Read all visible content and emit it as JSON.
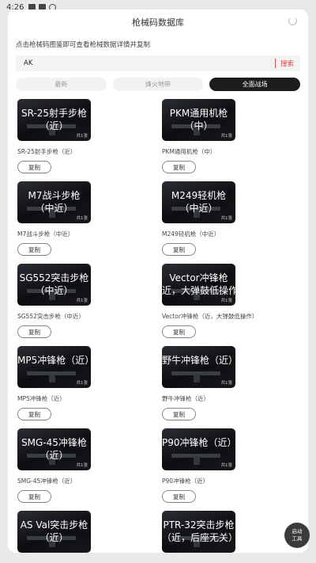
{
  "status_bar": {
    "time": "4:26"
  },
  "header": {
    "title": "枪械码数据库",
    "refresh_icon": "refresh-icon"
  },
  "hint": "点击枪械码图鉴即可查看枪械数据详情并复制",
  "search": {
    "value": "AK",
    "button": "搜索"
  },
  "tabs": [
    {
      "label": "最新",
      "active": false
    },
    {
      "label": "烽火地带",
      "active": false
    },
    {
      "label": "全面战场",
      "active": true
    }
  ],
  "items": [
    {
      "line1": "SR-25射手步枪",
      "line2": "（近）",
      "count": "共1张",
      "caption": "SR-25射手步枪（近）",
      "copy": "复制"
    },
    {
      "line1": "PKM通用机枪",
      "line2": "（中）",
      "count": "共1张",
      "caption": "PKM通用机枪（中）",
      "copy": "复制"
    },
    {
      "line1": "M7战斗步枪",
      "line2": "（中近）",
      "count": "共1张",
      "caption": "M7战斗步枪（中近）",
      "copy": "复制"
    },
    {
      "line1": "M249轻机枪",
      "line2": "（中近）",
      "count": "共1张",
      "caption": "M249轻机枪（中近）",
      "copy": "复制"
    },
    {
      "line1": "SG552突击步枪",
      "line2": "（中近）",
      "count": "共1张",
      "caption": "SG552突击步枪（中近）",
      "copy": "复制"
    },
    {
      "line1": "Vector冲锋枪",
      "line2": "近，大弹鼓低操作",
      "count": "共1张",
      "caption": "Vector冲锋枪（近，大弹鼓低操作）",
      "copy": "复制"
    },
    {
      "line1": "MP5冲锋枪（近）",
      "line2": "",
      "count": "共1张",
      "caption": "MP5冲锋枪（近）",
      "copy": "复制"
    },
    {
      "line1": "野牛冲锋枪（近）",
      "line2": "",
      "count": "共1张",
      "caption": "野牛冲锋枪（近）",
      "copy": "复制"
    },
    {
      "line1": "SMG-45冲锋枪",
      "line2": "（近）",
      "count": "共1张",
      "caption": "SMG-45冲锋枪（近）",
      "copy": "复制"
    },
    {
      "line1": "P90冲锋枪（近）",
      "line2": "",
      "count": "共1张",
      "caption": "P90冲锋枪（近）",
      "copy": "复制"
    },
    {
      "line1": "AS Val突击步枪",
      "line2": "（近）",
      "count": "",
      "caption": "",
      "copy": ""
    },
    {
      "line1": "PTR-32突击步枪",
      "line2": "（近，后座无关）",
      "count": "",
      "caption": "",
      "copy": ""
    }
  ],
  "fab": {
    "line1": "启动",
    "line2": "工具"
  }
}
